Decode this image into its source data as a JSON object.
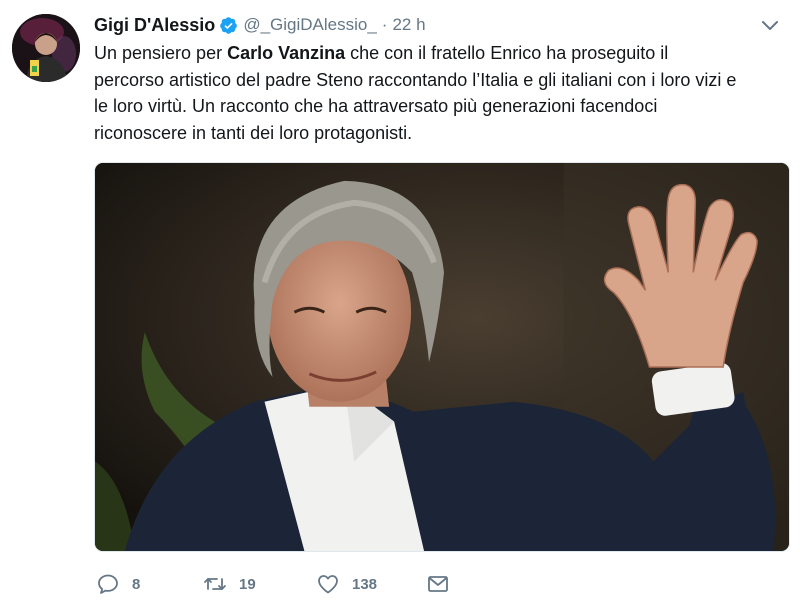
{
  "tweet": {
    "author": {
      "display_name": "Gigi D'Alessio",
      "handle": "@_GigiDAlessio_",
      "verified": true
    },
    "separator": "·",
    "time": "22 h",
    "text": {
      "line1_pre": "Un pensiero per ",
      "line1_bold": "Carlo Vanzina",
      "line1_post": " che con il fratello Enrico ha proseguito il",
      "line2": "percorso artistico del padre Steno raccontando l’Italia e gli italiani con i loro vizi e",
      "line3": "le loro virtù. Un racconto che ha attraversato più generazioni facendoci",
      "line4": "riconoscere in tanti dei loro protagonisti."
    },
    "actions": {
      "replies": "8",
      "retweets": "19",
      "likes": "138"
    }
  },
  "colors": {
    "text": "#14171a",
    "secondary": "#657786",
    "verified_blue": "#1da1f2",
    "border": "#e1e8ed"
  },
  "icons": {
    "verified": "verified-badge-icon",
    "caret": "chevron-down-icon",
    "reply": "reply-bubble-icon",
    "retweet": "retweet-arrows-icon",
    "like": "heart-icon",
    "dm": "envelope-icon"
  }
}
